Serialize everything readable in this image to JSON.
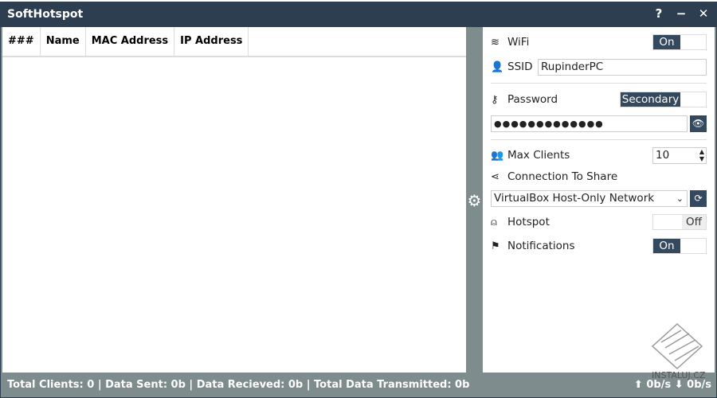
{
  "window": {
    "title": "SoftHotspot",
    "help": "?",
    "minimize": "−",
    "close": "✕"
  },
  "table": {
    "columns": [
      "###",
      "Name",
      "MAC Address",
      "IP Address"
    ],
    "rows": []
  },
  "settings": {
    "wifi": {
      "label": "WiFi",
      "state": "On"
    },
    "ssid": {
      "label": "SSID",
      "value": "RupinderPC"
    },
    "password": {
      "label": "Password",
      "mode": "Secondary",
      "value": "●●●●●●●●●●●●●"
    },
    "max_clients": {
      "label": "Max Clients",
      "value": "10"
    },
    "connection": {
      "label": "Connection To Share",
      "selected": "VirtualBox Host-Only Network"
    },
    "hotspot": {
      "label": "Hotspot",
      "state": "Off"
    },
    "notifications": {
      "label": "Notifications",
      "state": "On"
    }
  },
  "status": {
    "summary": "Total Clients: 0 | Data Sent: 0b | Data Recieved: 0b | Total Data Transmitted: 0b",
    "upload": "0b/s",
    "download": "0b/s"
  },
  "watermark": "INSTALUJ.CZ",
  "colors": {
    "titlebar": "#2c3e50",
    "accent": "#34495e",
    "frame": "#7f8c8d"
  }
}
